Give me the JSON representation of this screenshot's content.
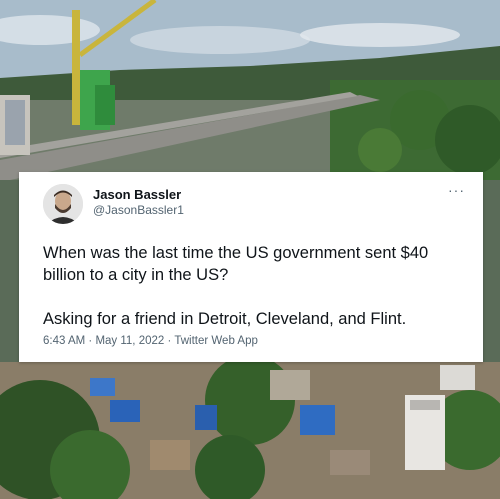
{
  "tweet": {
    "name": "Jason Bassler",
    "handle": "@JasonBassler1",
    "text_line1": "When was the last time the US government sent $40 billion to a city in the US?",
    "text_line2": "Asking for a friend in Detroit, Cleveland, and Flint.",
    "time": "6:43 AM",
    "date": "May 11, 2022",
    "source": "Twitter Web App",
    "separator": "·",
    "more_glyph": "···"
  },
  "photo": {
    "sky_color": "#9fb6c8",
    "road_color": "#8b8a86",
    "crane_color": "#c7b23a",
    "machine_color": "#3aa24a",
    "tree_color": "#2f5a28",
    "tarp_color": "#2a63b8"
  }
}
